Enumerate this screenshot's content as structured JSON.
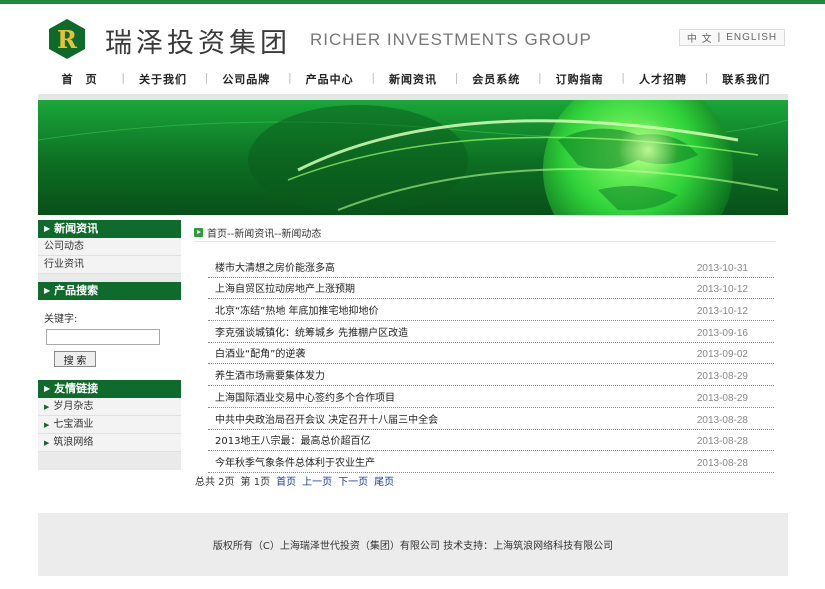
{
  "header": {
    "logo_letter": "R",
    "company_cn": "瑞泽投资集团",
    "company_en": "RICHER INVESTMENTS GROUP",
    "lang_cn": "中 文",
    "lang_sep": "|",
    "lang_en": "ENGLISH"
  },
  "nav": {
    "items": [
      "首　页",
      "关于我们",
      "公司品牌",
      "产品中心",
      "新闻资讯",
      "会员系统",
      "订购指南",
      "人才招聘",
      "联系我们"
    ]
  },
  "sidebar": {
    "news_title": "新闻资讯",
    "news_links": [
      "公司动态",
      "行业资讯"
    ],
    "search_title": "产品搜索",
    "keyword_label": "关键字:",
    "keyword_value": "",
    "search_button": "搜 索",
    "links_title": "友情链接",
    "friend_links": [
      "岁月杂志",
      "七宝酒业",
      "筑浪网络"
    ]
  },
  "main": {
    "breadcrumb": "首页--新闻资讯--新闻动态",
    "news": [
      {
        "title": "楼市大清想之房价能涨多高",
        "date": "2013-10-31"
      },
      {
        "title": "上海自贸区拉动房地产上涨预期",
        "date": "2013-10-12"
      },
      {
        "title": "北京“冻结”热地 年底加推宅地抑地价",
        "date": "2013-10-12"
      },
      {
        "title": "李克强谈城镇化：统筹城乡 先推棚户区改造",
        "date": "2013-09-16"
      },
      {
        "title": "白酒业“配角”的逆袭",
        "date": "2013-09-02"
      },
      {
        "title": "养生酒市场需要集体发力",
        "date": "2013-08-29"
      },
      {
        "title": "上海国际酒业交易中心签约多个合作项目",
        "date": "2013-08-29"
      },
      {
        "title": "中共中央政治局召开会议 决定召开十八届三中全会",
        "date": "2013-08-28"
      },
      {
        "title": "2013地王八宗最：最高总价超百亿",
        "date": "2013-08-28"
      },
      {
        "title": "今年秋季气象条件总体利于农业生产",
        "date": "2013-08-28"
      }
    ],
    "pager": {
      "total": "总共 2页",
      "current": "第 1页",
      "first": "首页",
      "prev": "上一页",
      "next": "下一页",
      "last": "尾页"
    }
  },
  "footer": {
    "copyright": "版权所有（C）上海瑞泽世代投资（集团）有限公司 技术支持：上海筑浪网络科技有限公司"
  },
  "colors": {
    "brand_green": "#0f6b2c",
    "accent_green": "#1f8a3a",
    "logo_gold": "#e8c230",
    "link_blue": "#1a3e9c"
  }
}
